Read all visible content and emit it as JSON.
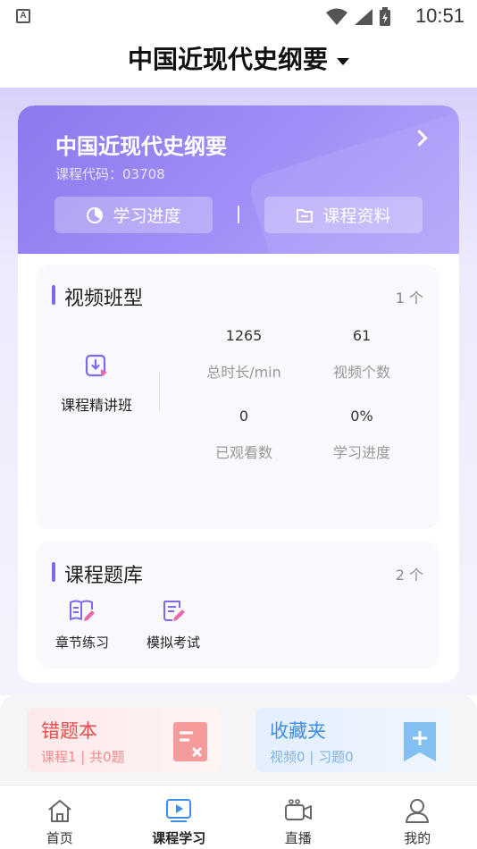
{
  "status_bar": {
    "time": "10:51",
    "notification_icon": "A"
  },
  "header": {
    "title": "中国近现代史纲要"
  },
  "course": {
    "name": "中国近现代史纲要",
    "code": "课程代码：03708",
    "progress_label": "学习进度",
    "materials_label": "课程资料"
  },
  "video_section": {
    "title": "视频班型",
    "count": "1 个",
    "class_name": "课程精讲班",
    "stats": [
      {
        "value": "1265",
        "label": "总时长/min"
      },
      {
        "value": "61",
        "label": "视频个数"
      },
      {
        "value": "0",
        "label": "已观看数"
      },
      {
        "value": "0%",
        "label": "学习进度"
      }
    ]
  },
  "bank_section": {
    "title": "课程题库",
    "count": "2 个",
    "items": [
      {
        "label": "章节练习"
      },
      {
        "label": "模拟考试"
      }
    ]
  },
  "promos": {
    "wrong": {
      "title": "错题本",
      "subtitle": "课程1 | 共0题"
    },
    "favorites": {
      "title": "收藏夹",
      "subtitle": "视频0 | 习题0"
    }
  },
  "nav": {
    "items": [
      {
        "label": "首页",
        "icon": "home-icon"
      },
      {
        "label": "课程学习",
        "icon": "play-icon"
      },
      {
        "label": "直播",
        "icon": "live-camera-icon"
      },
      {
        "label": "我的",
        "icon": "user-icon"
      }
    ],
    "active_index": 1
  },
  "colors": {
    "accent": "#7b6aec",
    "wrong": "#e74c4c",
    "favorites": "#3d8fe6"
  }
}
